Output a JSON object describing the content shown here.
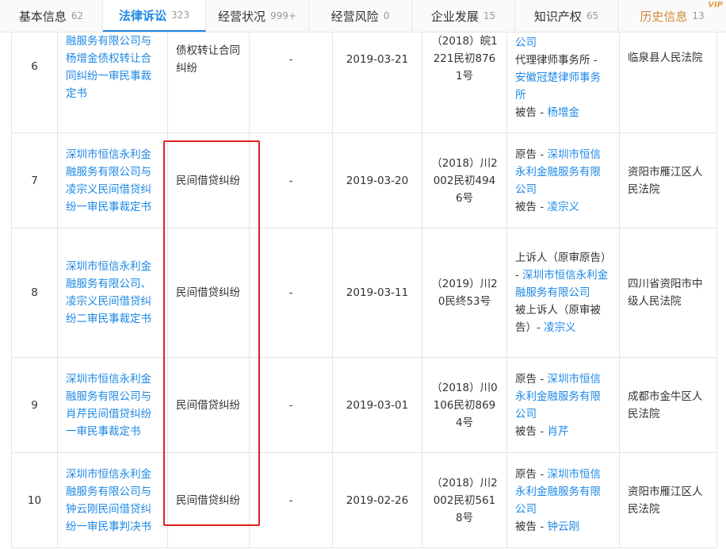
{
  "tabs": [
    {
      "label": "基本信息",
      "count": "62",
      "active": false,
      "vip": false
    },
    {
      "label": "法律诉讼",
      "count": "323",
      "active": true,
      "vip": false
    },
    {
      "label": "经营状况",
      "count": "999+",
      "active": false,
      "vip": false
    },
    {
      "label": "经营风险",
      "count": "0",
      "active": false,
      "vip": false
    },
    {
      "label": "企业发展",
      "count": "15",
      "active": false,
      "vip": false
    },
    {
      "label": "知识产权",
      "count": "65",
      "active": false,
      "vip": false
    },
    {
      "label": "历史信息",
      "count": "13",
      "active": false,
      "vip": true
    }
  ],
  "vip_label": "VIP",
  "rows": [
    {
      "no": "6",
      "title": "深圳市恒信永利金融服务有限公司与杨增金债权转让合同纠纷一审民事裁定书",
      "title_visible": "融服务有限公司与杨增金债权转让合同纠纷一审民事裁定书",
      "cause": "债权转让合同纠纷",
      "amount": "-",
      "date": "2019-03-21",
      "case_no": "（2018）皖1221民初8761号",
      "parties": [
        {
          "role": "",
          "name": "公司"
        },
        {
          "role": "代理律师事务所 - ",
          "name": "安徽冠楚律师事务所"
        },
        {
          "role": "被告 - ",
          "name": "杨增金"
        }
      ],
      "court": "临泉县人民法院"
    },
    {
      "no": "7",
      "title": "深圳市恒信永利金融服务有限公司与凌宗义民间借贷纠纷一审民事裁定书",
      "cause": "民间借贷纠纷",
      "amount": "-",
      "date": "2019-03-20",
      "case_no": "（2018）川2002民初4946号",
      "parties": [
        {
          "role": "原告 - ",
          "name": "深圳市恒信永利金融服务有限公司"
        },
        {
          "role": "被告 - ",
          "name": "凌宗义"
        }
      ],
      "court": "资阳市雁江区人民法院"
    },
    {
      "no": "8",
      "title": "深圳市恒信永利金融服务有限公司、凌宗义民间借贷纠纷二审民事裁定书",
      "cause": "民间借贷纠纷",
      "amount": "-",
      "date": "2019-03-11",
      "case_no": "（2019）川20民终53号",
      "parties": [
        {
          "role": "上诉人（原审原告）- ",
          "name": "深圳市恒信永利金融服务有限公司"
        },
        {
          "role": "被上诉人（原审被告）- ",
          "name": "凌宗义"
        }
      ],
      "court": "四川省资阳市中级人民法院"
    },
    {
      "no": "9",
      "title": "深圳市恒信永利金融服务有限公司与肖芹民间借贷纠纷一审民事裁定书",
      "cause": "民间借贷纠纷",
      "amount": "-",
      "date": "2019-03-01",
      "case_no": "（2018）川0106民初8694号",
      "parties": [
        {
          "role": "原告 - ",
          "name": "深圳市恒信永利金融服务有限公司"
        },
        {
          "role": "被告 - ",
          "name": "肖芹"
        }
      ],
      "court": "成都市金牛区人民法院"
    },
    {
      "no": "10",
      "title": "深圳市恒信永利金融服务有限公司与钟云刚民间借贷纠纷一审民事判决书",
      "cause": "民间借贷纠纷",
      "amount": "-",
      "date": "2019-02-26",
      "case_no": "（2018）川2002民初5618号",
      "parties": [
        {
          "role": "原告 - ",
          "name": "深圳市恒信永利金融服务有限公司"
        },
        {
          "role": "被告 - ",
          "name": "钟云刚"
        }
      ],
      "court": "资阳市雁江区人民法院"
    }
  ],
  "colors": {
    "link": "#1e88e5",
    "active_tab": "#1e88e5",
    "highlight": "#e02020",
    "history_tab": "#d08b3e"
  }
}
